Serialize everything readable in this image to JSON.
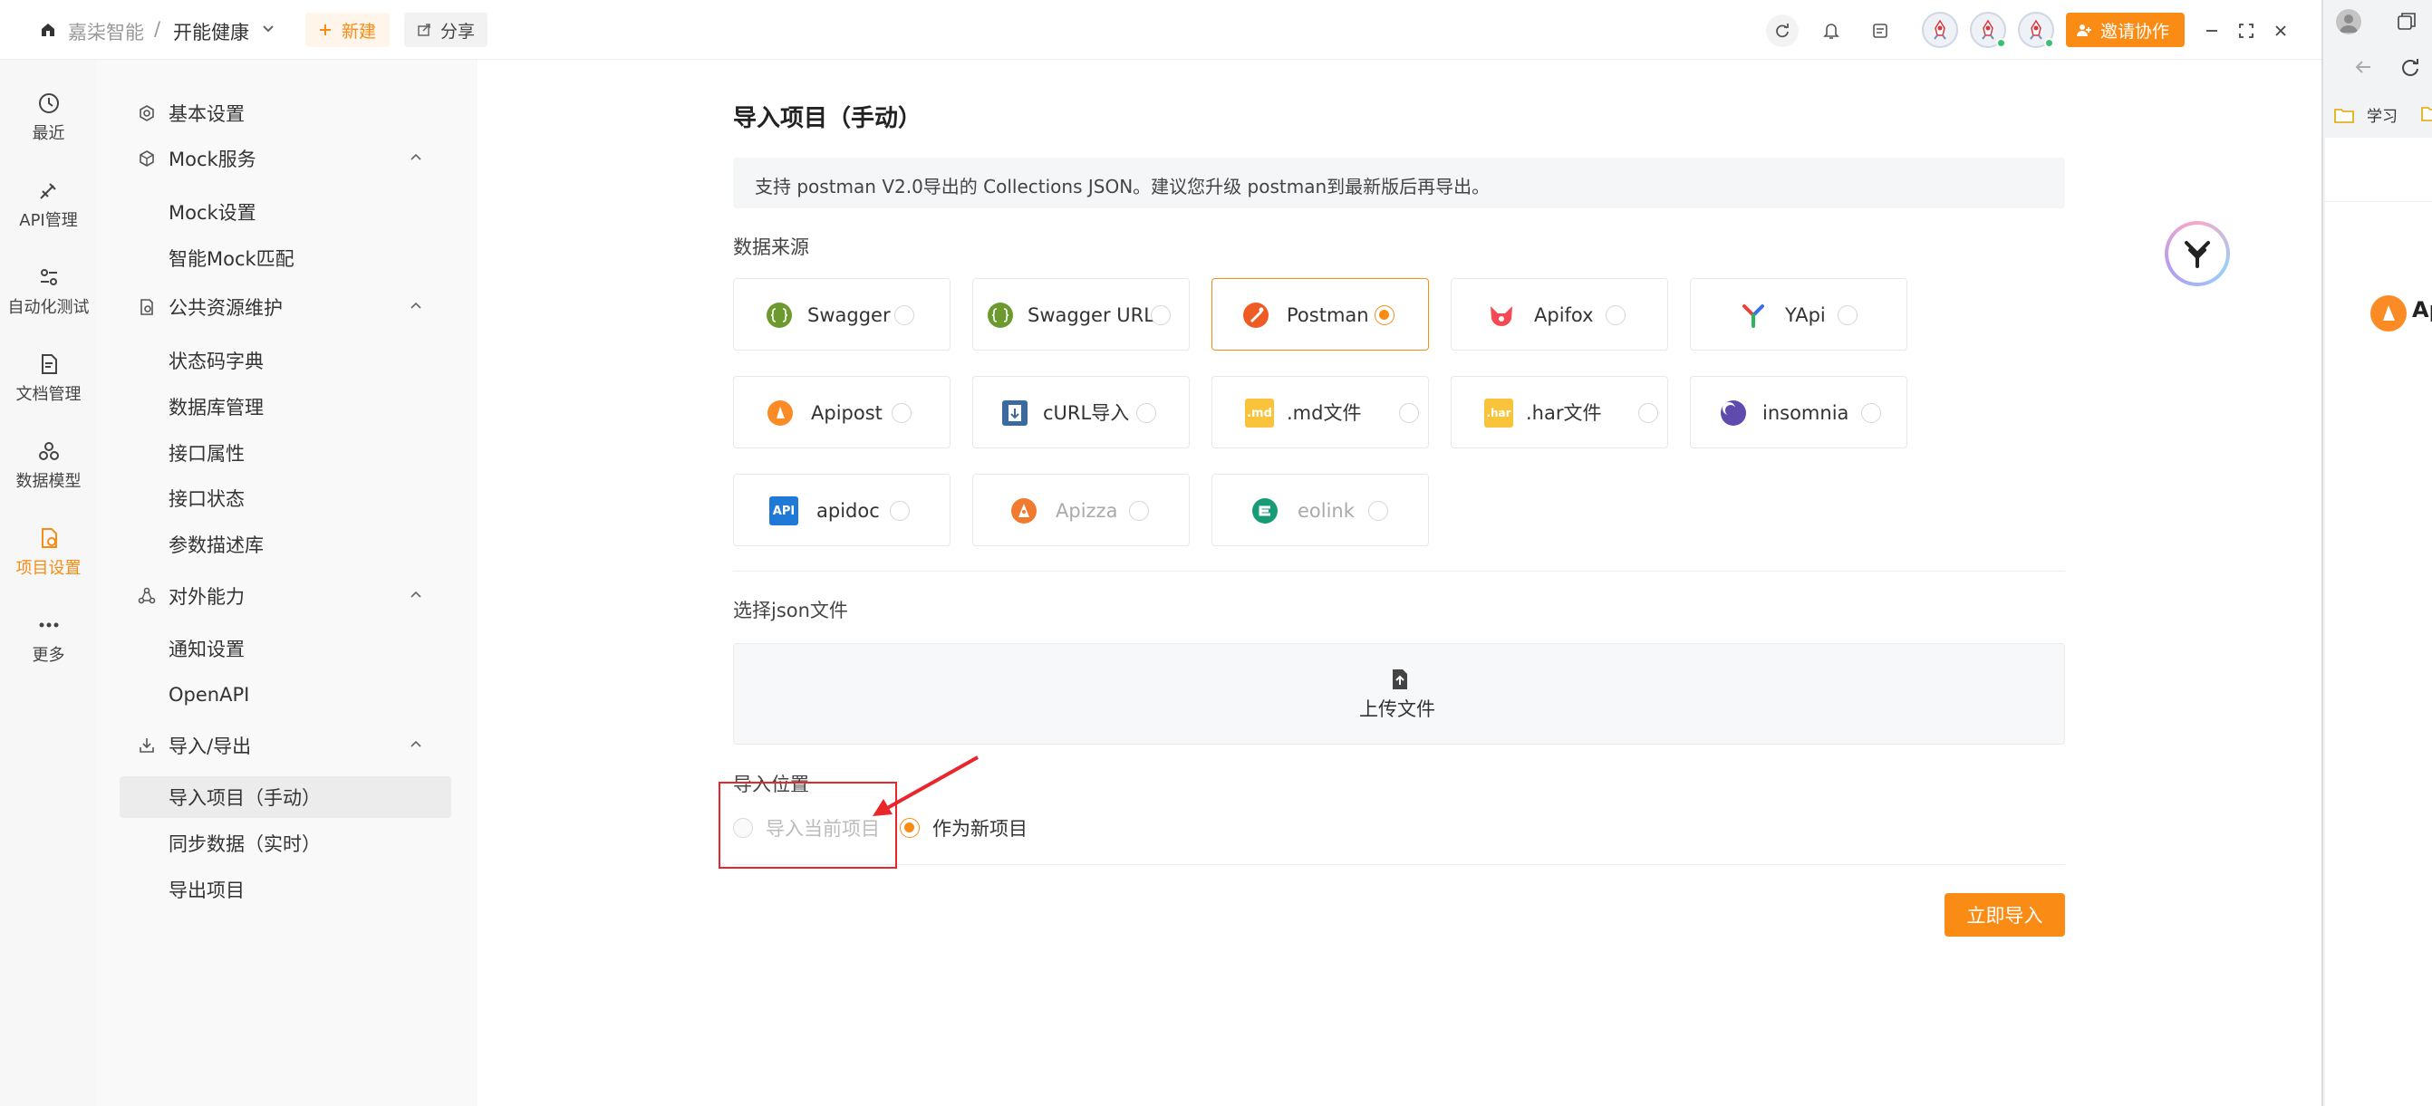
{
  "topbar": {
    "team": "嘉柒智能",
    "separator": "/",
    "project": "开能健康",
    "new_label": "新建",
    "share_label": "分享",
    "invite_label": "邀请协作"
  },
  "rail": [
    {
      "label": "最近",
      "icon": "clock-icon"
    },
    {
      "label": "API管理",
      "icon": "api-plug-icon"
    },
    {
      "label": "自动化测试",
      "icon": "sliders-icon"
    },
    {
      "label": "文档管理",
      "icon": "document-icon"
    },
    {
      "label": "数据模型",
      "icon": "data-model-icon"
    },
    {
      "label": "项目设置",
      "icon": "settings-icon",
      "active": true
    },
    {
      "label": "更多",
      "icon": "more-icon"
    }
  ],
  "menu": {
    "basic": "基本设置",
    "mock": "Mock服务",
    "mock_items": [
      "Mock设置",
      "智能Mock匹配"
    ],
    "public": "公共资源维护",
    "public_items": [
      "状态码字典",
      "数据库管理",
      "接口属性",
      "接口状态",
      "参数描述库"
    ],
    "external": "对外能力",
    "external_items": [
      "通知设置",
      "OpenAPI"
    ],
    "io": "导入/导出",
    "io_items": [
      "导入项目（手动）",
      "同步数据（实时）",
      "导出项目"
    ]
  },
  "main": {
    "title": "导入项目（手动）",
    "notice": "支持 postman V2.0导出的 Collections JSON。建议您升级 postman到最新版后再导出。",
    "source_label": "数据来源",
    "sources": [
      {
        "label": "Swagger",
        "icon": "swagger-icon",
        "selected": false,
        "disabled": false
      },
      {
        "label": "Swagger URL",
        "icon": "swagger-url-icon",
        "selected": false,
        "disabled": false
      },
      {
        "label": "Postman",
        "icon": "postman-icon",
        "selected": true,
        "disabled": false
      },
      {
        "label": "Apifox",
        "icon": "apifox-icon",
        "selected": false,
        "disabled": false
      },
      {
        "label": "YApi",
        "icon": "yapi-icon",
        "selected": false,
        "disabled": false
      },
      {
        "label": "Apipost",
        "icon": "apipost-icon",
        "selected": false,
        "disabled": false
      },
      {
        "label": "cURL导入",
        "icon": "curl-icon",
        "selected": false,
        "disabled": false
      },
      {
        "label": ".md文件",
        "icon": "md-file-icon",
        "selected": false,
        "disabled": false
      },
      {
        "label": ".har文件",
        "icon": "har-file-icon",
        "selected": false,
        "disabled": false
      },
      {
        "label": "insomnia",
        "icon": "insomnia-icon",
        "selected": false,
        "disabled": false
      },
      {
        "label": "apidoc",
        "icon": "apidoc-icon",
        "selected": false,
        "disabled": false
      },
      {
        "label": "Apizza",
        "icon": "apizza-icon",
        "selected": false,
        "disabled": true
      },
      {
        "label": "eolink",
        "icon": "eolink-icon",
        "selected": false,
        "disabled": true
      }
    ],
    "icon_text": {
      "md": ".md",
      "har": ".har",
      "api": "API"
    },
    "file_label": "选择json文件",
    "upload_label": "上传文件",
    "position_label": "导入位置",
    "position_current": "导入当前项目",
    "position_new": "作为新项目",
    "import_button": "立即导入"
  },
  "browser": {
    "bookmark": "学习",
    "tab_fragment": "Ap"
  },
  "colors": {
    "accent": "#fa8c16",
    "annotation": "#e8262b"
  }
}
